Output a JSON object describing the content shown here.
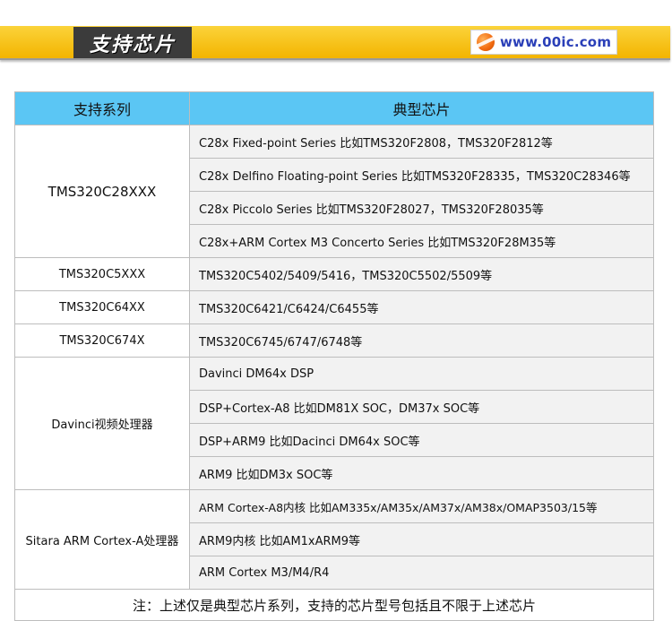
{
  "banner": {
    "title": "支持芯片",
    "logo_text": "www.00ic.com"
  },
  "table": {
    "headers": [
      "支持系列",
      "典型芯片"
    ],
    "groups": [
      {
        "series": "TMS320C28XXX",
        "chips": [
          "C28x Fixed-point Series 比如TMS320F2808，TMS320F2812等",
          "C28x Delfino Floating-point Series 比如TMS320F28335，TMS320C28346等",
          "C28x Piccolo Series 比如TMS320F28027，TMS320F28035等",
          "C28x+ARM Cortex M3 Concerto Series 比如TMS320F28M35等"
        ]
      },
      {
        "series": "TMS320C5XXX",
        "chips": [
          "TMS320C5402/5409/5416，TMS320C5502/5509等"
        ]
      },
      {
        "series": "TMS320C64XX",
        "chips": [
          "TMS320C6421/C6424/C6455等"
        ]
      },
      {
        "series": "TMS320C674X",
        "chips": [
          "TMS320C6745/6747/6748等"
        ]
      },
      {
        "series": "Davinci视频处理器",
        "chips": [
          "Davinci DM64x DSP",
          "DSP+Cortex-A8 比如DM81X SOC，DM37x SOC等",
          "DSP+ARM9 比如Dacinci DM64x SOC等",
          "ARM9 比如DM3x SOC等"
        ]
      },
      {
        "series": "Sitara ARM Cortex-A处理器",
        "chips": [
          "ARM Cortex-A8内核 比如AM335x/AM35x/AM37x/AM38x/OMAP3503/15等",
          "ARM9内核 比如AM1xARM9等",
          "ARM Cortex M3/M4/R4"
        ]
      }
    ],
    "footnote": "注：上述仅是典型芯片系列，支持的芯片型号包括且不限于上述芯片"
  }
}
